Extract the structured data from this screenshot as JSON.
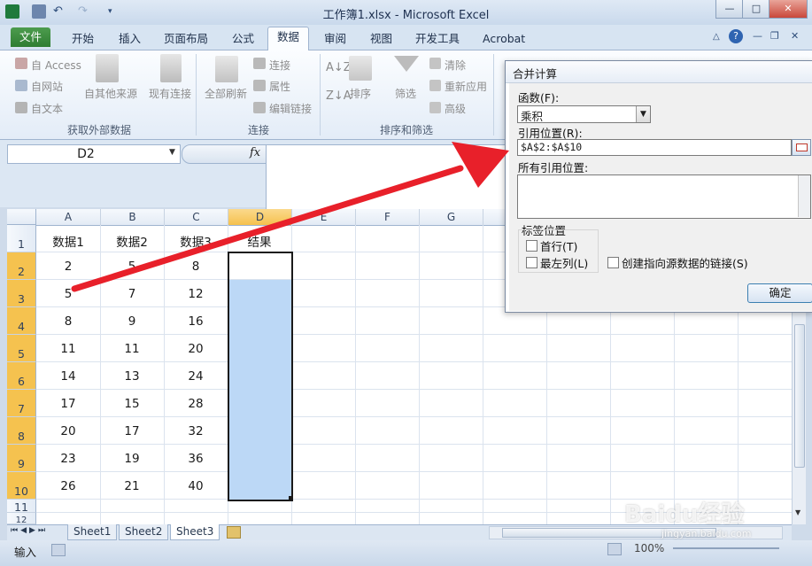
{
  "window": {
    "title": "工作簿1.xlsx - Microsoft Excel",
    "controls": {
      "minimize": "—",
      "maximize": "□",
      "close": "✕"
    }
  },
  "ribbon_tabs": [
    "文件",
    "开始",
    "插入",
    "页面布局",
    "公式",
    "数据",
    "审阅",
    "视图",
    "开发工具",
    "Acrobat"
  ],
  "active_tab": "数据",
  "ribbon": {
    "external": {
      "access": "自 Access",
      "web": "自网站",
      "text": "自文本",
      "other": "自其他来源",
      "existing": "现有连接",
      "group": "获取外部数据"
    },
    "connections": {
      "refresh_all": "全部刷新",
      "connections": "连接",
      "properties": "属性",
      "edit_links": "编辑链接",
      "group": "连接"
    },
    "sort": {
      "sort": "排序",
      "filter": "筛选",
      "clear": "清除",
      "reapply": "重新应用",
      "advanced": "高级",
      "group": "排序和筛选"
    }
  },
  "formula_bar": {
    "name_box": "D2",
    "fx": "fx",
    "formula": ""
  },
  "columns": [
    "A",
    "B",
    "C",
    "D",
    "E",
    "F",
    "G"
  ],
  "rows": [
    "1",
    "2",
    "3",
    "4",
    "5",
    "6",
    "7",
    "8",
    "9",
    "10",
    "11",
    "12"
  ],
  "table": {
    "headers": [
      "数据1",
      "数据2",
      "数据3",
      "结果"
    ],
    "data": [
      [
        "2",
        "5",
        "8"
      ],
      [
        "5",
        "7",
        "12"
      ],
      [
        "8",
        "9",
        "16"
      ],
      [
        "11",
        "11",
        "20"
      ],
      [
        "14",
        "13",
        "24"
      ],
      [
        "17",
        "15",
        "28"
      ],
      [
        "20",
        "17",
        "32"
      ],
      [
        "23",
        "19",
        "36"
      ],
      [
        "26",
        "21",
        "40"
      ]
    ]
  },
  "sheet_tabs": [
    "Sheet1",
    "Sheet2",
    "Sheet3"
  ],
  "active_sheet": "Sheet3",
  "status": {
    "mode": "输入",
    "zoom": "100%"
  },
  "dialog": {
    "title": "合并计算",
    "function_label": "函数(F):",
    "function_value": "乘积",
    "reference_label": "引用位置(R):",
    "reference_value": "$A$2:$A$10",
    "all_refs_label": "所有引用位置:",
    "label_pos_label": "标签位置",
    "top_row": "首行(T)",
    "left_col": "最左列(L)",
    "link_source": "创建指向源数据的链接(S)",
    "ok": "确定"
  },
  "colors": {
    "selection": "#bcd8f6",
    "accent_red": "#e8202a",
    "file_tab": "#2f7d32"
  },
  "watermark": {
    "brand": "Baidu经验",
    "url": "jingyan.baidu.com"
  }
}
